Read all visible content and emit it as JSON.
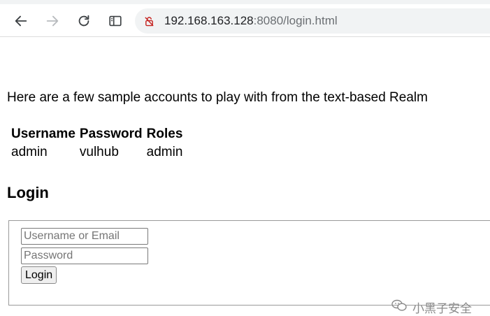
{
  "browser": {
    "url_host": "192.168.163.128",
    "url_rest": ":8080/login.html",
    "icons": [
      "back-arrow-icon",
      "forward-arrow-icon",
      "reload-icon",
      "sidebar-icon",
      "not-secure-icon"
    ]
  },
  "page": {
    "intro": "Here are a few sample accounts to play with from the text-based Realm",
    "table": {
      "headers": [
        "Username",
        "Password",
        "Roles"
      ],
      "rows": [
        [
          "admin",
          "vulhub",
          "admin"
        ]
      ]
    },
    "login_heading": "Login",
    "form": {
      "username_placeholder": "Username or Email",
      "password_placeholder": "Password",
      "submit_label": "Login"
    }
  },
  "watermark": {
    "text": "小黑子安全"
  }
}
